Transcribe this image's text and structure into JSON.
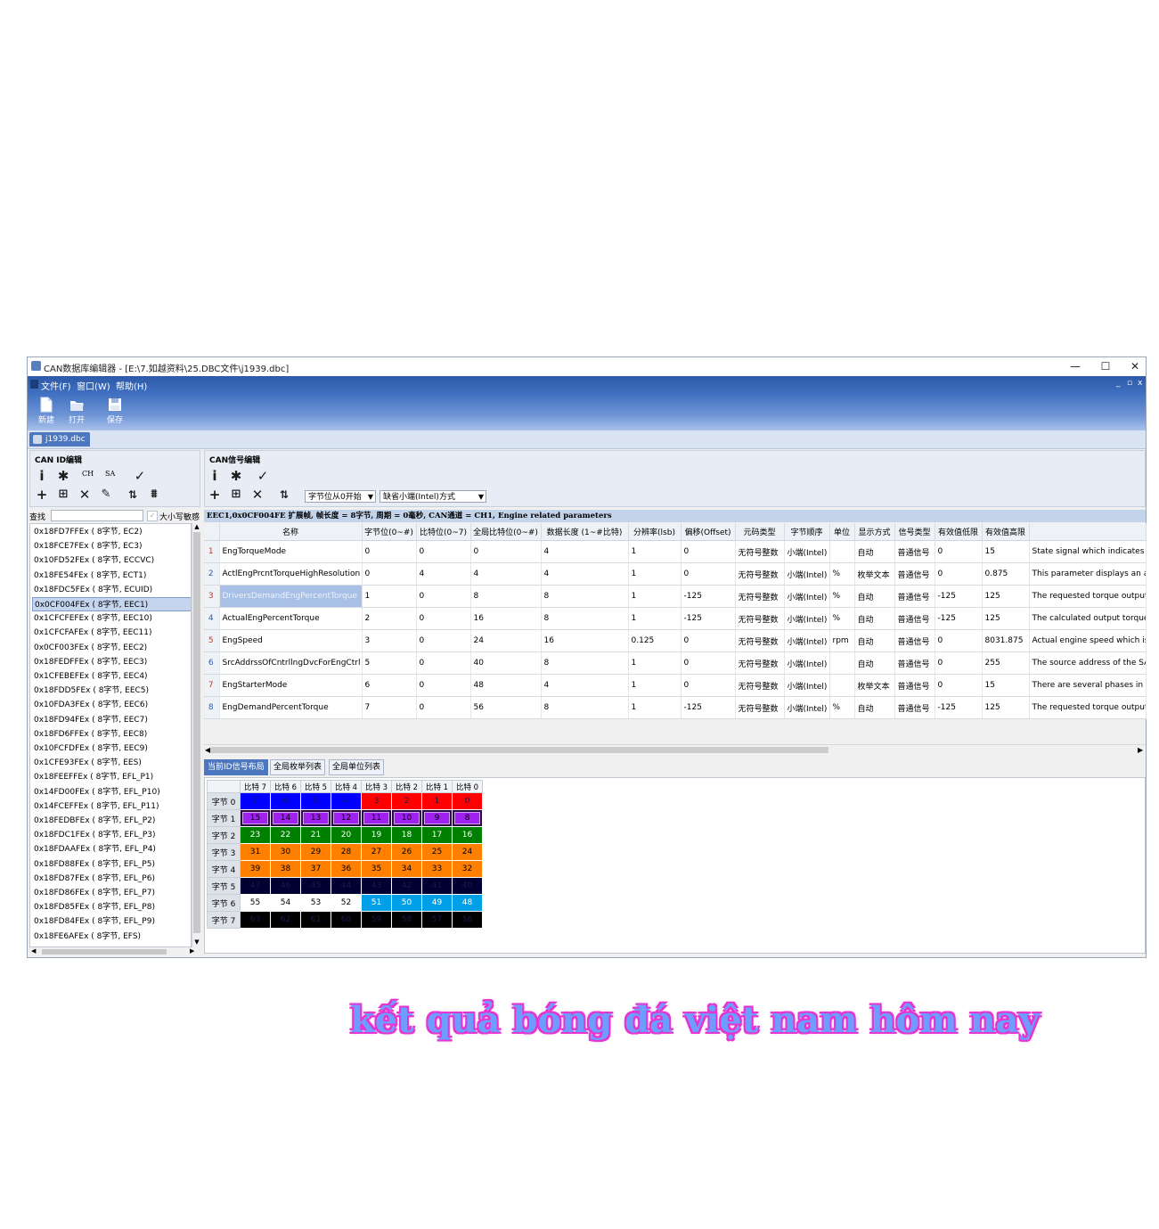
{
  "window": {
    "title": "CAN数据库编辑器 - [E:\\7.如越资料\\25.DBC文件\\j1939.dbc]",
    "minimize": "—",
    "maximize": "☐",
    "close": "✕"
  },
  "menu": {
    "items": [
      "文件(F)",
      "窗口(W)",
      "帮助(H)"
    ],
    "mdi_controls": [
      "_",
      "▫",
      "x"
    ]
  },
  "toolbar": {
    "new_label": "新建",
    "open_label": "打开",
    "save_label": "保存"
  },
  "doc_tab": {
    "label": "j1939.dbc"
  },
  "id_panel": {
    "header": "CAN ID编辑",
    "ch_label": "CH",
    "sa_label": "SA",
    "search_label": "查找",
    "search_value": "",
    "case_sensitive_label": "大小写敏感",
    "case_sensitive_checked": true,
    "selected_index": 5,
    "items": [
      "0x18FD7FFEx ( 8字节, EC2)",
      "0x18FCE7FEx ( 8字节, EC3)",
      "0x10FD52FEx ( 8字节, ECCVC)",
      "0x18FE54FEx ( 8字节, ECT1)",
      "0x18FDC5FEx ( 8字节, ECUID)",
      "0x0CF004FEx ( 8字节, EEC1)",
      "0x1CFCFEFEx ( 8字节, EEC10)",
      "0x1CFCFAFEx ( 8字节, EEC11)",
      "0x0CF003FEx ( 8字节, EEC2)",
      "0x18FEDFFEx ( 8字节, EEC3)",
      "0x1CFEBEFEx ( 8字节, EEC4)",
      "0x18FDD5FEx ( 8字节, EEC5)",
      "0x10FDA3FEx ( 8字节, EEC6)",
      "0x18FD94FEx ( 8字节, EEC7)",
      "0x18FD6FFEx ( 8字节, EEC8)",
      "0x10FCFDFEx ( 8字节, EEC9)",
      "0x1CFE93FEx ( 8字节, EES)",
      "0x18FEEFFEx ( 8字节, EFL_P1)",
      "0x14FD00FEx ( 8字节, EFL_P10)",
      "0x14FCEFFEx ( 8字节, EFL_P11)",
      "0x18FEDBFEx ( 8字节, EFL_P2)",
      "0x18FDC1FEx ( 8字节, EFL_P3)",
      "0x18FDAAFEx ( 8字节, EFL_P4)",
      "0x18FD88FEx ( 8字节, EFL_P5)",
      "0x18FD87FEx ( 8字节, EFL_P6)",
      "0x18FD86FEx ( 8字节, EFL_P7)",
      "0x18FD85FEx ( 8字节, EFL_P8)",
      "0x18FD84FEx ( 8字节, EFL_P9)",
      "0x18FE6AFEx ( 8字节, EFS)"
    ]
  },
  "signal_panel": {
    "header": "CAN信号编辑",
    "byte_start_option": "字节位从0开始",
    "byte_order_option": "缺省小端(Intel)方式",
    "info_bar": "EEC1,0x0CF004FE 扩展帧, 帧长度 = 8字节, 周期 = 0毫秒, CAN通道 = CH1, Engine related parameters",
    "columns": [
      "",
      "名称",
      "字节位(0~#)",
      "比特位(0~7)",
      "全局比特位(0~#)",
      "数据长度 (1~#比特)",
      "分辨率(lsb)",
      "偏移(Offset)",
      "元码类型",
      "字节顺序",
      "单位",
      "显示方式",
      "信号类型",
      "有效值低限",
      "有效值高限",
      ""
    ],
    "highlighted_row": 2,
    "rows": [
      [
        "1",
        "EngTorqueMode",
        "0",
        "0",
        "0",
        "4",
        "1",
        "0",
        "无符号整数",
        "小端(Intel)",
        "",
        "自动",
        "普通信号",
        "0",
        "15",
        "State signal which indicates w"
      ],
      [
        "2",
        "ActlEngPrcntTorqueHighResolution",
        "0",
        "4",
        "4",
        "4",
        "1",
        "0",
        "无符号整数",
        "小端(Intel)",
        "%",
        "枚举文本",
        "普通信号",
        "0",
        "0.875",
        "This parameter displays an ad"
      ],
      [
        "3",
        "DriversDemandEngPercentTorque",
        "1",
        "0",
        "8",
        "8",
        "1",
        "-125",
        "无符号整数",
        "小端(Intel)",
        "%",
        "自动",
        "普通信号",
        "-125",
        "125",
        "The requested torque output"
      ],
      [
        "4",
        "ActualEngPercentTorque",
        "2",
        "0",
        "16",
        "8",
        "1",
        "-125",
        "无符号整数",
        "小端(Intel)",
        "%",
        "自动",
        "普通信号",
        "-125",
        "125",
        "The calculated output torque"
      ],
      [
        "5",
        "EngSpeed",
        "3",
        "0",
        "24",
        "16",
        "0.125",
        "0",
        "无符号整数",
        "小端(Intel)",
        "rpm",
        "自动",
        "普通信号",
        "0",
        "8031.875",
        "Actual engine speed which is"
      ],
      [
        "6",
        "SrcAddrssOfCntrllngDvcForEngCtrl",
        "5",
        "0",
        "40",
        "8",
        "1",
        "0",
        "无符号整数",
        "小端(Intel)",
        "",
        "自动",
        "普通信号",
        "0",
        "255",
        "The source address of the SA"
      ],
      [
        "7",
        "EngStarterMode",
        "6",
        "0",
        "48",
        "4",
        "1",
        "0",
        "无符号整数",
        "小端(Intel)",
        "",
        "枚举文本",
        "普通信号",
        "0",
        "15",
        "There are several phases in a"
      ],
      [
        "8",
        "EngDemandPercentTorque",
        "7",
        "0",
        "56",
        "8",
        "1",
        "-125",
        "无符号整数",
        "小端(Intel)",
        "%",
        "自动",
        "普通信号",
        "-125",
        "125",
        "The requested torque output"
      ]
    ]
  },
  "bottom_tabs": [
    "当前ID信号布局",
    "全局枚举列表",
    "全局单位列表"
  ],
  "bit_layout": {
    "bit_headers": [
      "比特 7",
      "比特 6",
      "比特 5",
      "比特 4",
      "比特 3",
      "比特 2",
      "比特 1",
      "比特 0"
    ],
    "byte_labels": [
      "字节 0",
      "字节 1",
      "字节 2",
      "字节 3",
      "字节 4",
      "字节 5",
      "字节 6",
      "字节 7"
    ],
    "colors": {
      "blue": "#0000ff",
      "red": "#ff0000",
      "purple": "#a020f0",
      "green": "#008000",
      "orange": "#ff8000",
      "navy": "#000033",
      "white": "#ffffff",
      "sky": "#00a0e8",
      "black": "#000000"
    },
    "rows": [
      {
        "cells": [
          {
            "n": "7",
            "c": "blue"
          },
          {
            "n": "6",
            "c": "blue"
          },
          {
            "n": "5",
            "c": "blue"
          },
          {
            "n": "4",
            "c": "blue"
          },
          {
            "n": "3",
            "c": "red"
          },
          {
            "n": "2",
            "c": "red"
          },
          {
            "n": "1",
            "c": "red"
          },
          {
            "n": "0",
            "c": "red"
          }
        ]
      },
      {
        "cells": [
          {
            "n": "15",
            "c": "purple",
            "b": true
          },
          {
            "n": "14",
            "c": "purple",
            "b": true
          },
          {
            "n": "13",
            "c": "purple",
            "b": true
          },
          {
            "n": "12",
            "c": "purple",
            "b": true
          },
          {
            "n": "11",
            "c": "purple",
            "b": true
          },
          {
            "n": "10",
            "c": "purple",
            "b": true
          },
          {
            "n": "9",
            "c": "purple",
            "b": true
          },
          {
            "n": "8",
            "c": "purple",
            "b": true
          }
        ]
      },
      {
        "cells": [
          {
            "n": "23",
            "c": "green"
          },
          {
            "n": "22",
            "c": "green"
          },
          {
            "n": "21",
            "c": "green"
          },
          {
            "n": "20",
            "c": "green"
          },
          {
            "n": "19",
            "c": "green"
          },
          {
            "n": "18",
            "c": "green"
          },
          {
            "n": "17",
            "c": "green"
          },
          {
            "n": "16",
            "c": "green"
          }
        ]
      },
      {
        "cells": [
          {
            "n": "31",
            "c": "orange"
          },
          {
            "n": "30",
            "c": "orange"
          },
          {
            "n": "29",
            "c": "orange"
          },
          {
            "n": "28",
            "c": "orange"
          },
          {
            "n": "27",
            "c": "orange"
          },
          {
            "n": "26",
            "c": "orange"
          },
          {
            "n": "25",
            "c": "orange"
          },
          {
            "n": "24",
            "c": "orange"
          }
        ]
      },
      {
        "cells": [
          {
            "n": "39",
            "c": "orange"
          },
          {
            "n": "38",
            "c": "orange"
          },
          {
            "n": "37",
            "c": "orange"
          },
          {
            "n": "36",
            "c": "orange"
          },
          {
            "n": "35",
            "c": "orange"
          },
          {
            "n": "34",
            "c": "orange"
          },
          {
            "n": "33",
            "c": "orange"
          },
          {
            "n": "32",
            "c": "orange"
          }
        ]
      },
      {
        "cells": [
          {
            "n": "47",
            "c": "navy"
          },
          {
            "n": "46",
            "c": "navy"
          },
          {
            "n": "45",
            "c": "navy"
          },
          {
            "n": "44",
            "c": "navy"
          },
          {
            "n": "43",
            "c": "navy"
          },
          {
            "n": "42",
            "c": "navy"
          },
          {
            "n": "41",
            "c": "navy"
          },
          {
            "n": "40",
            "c": "navy"
          }
        ]
      },
      {
        "cells": [
          {
            "n": "55",
            "c": "white"
          },
          {
            "n": "54",
            "c": "white"
          },
          {
            "n": "53",
            "c": "white"
          },
          {
            "n": "52",
            "c": "white"
          },
          {
            "n": "51",
            "c": "sky"
          },
          {
            "n": "50",
            "c": "sky"
          },
          {
            "n": "49",
            "c": "sky"
          },
          {
            "n": "48",
            "c": "sky"
          }
        ]
      },
      {
        "cells": [
          {
            "n": "63",
            "c": "black"
          },
          {
            "n": "62",
            "c": "black"
          },
          {
            "n": "61",
            "c": "black"
          },
          {
            "n": "60",
            "c": "black"
          },
          {
            "n": "59",
            "c": "black"
          },
          {
            "n": "58",
            "c": "black"
          },
          {
            "n": "57",
            "c": "black"
          },
          {
            "n": "56",
            "c": "black"
          }
        ]
      }
    ]
  },
  "watermark": {
    "text": "kết quả bóng đá việt nam hôm nay"
  }
}
